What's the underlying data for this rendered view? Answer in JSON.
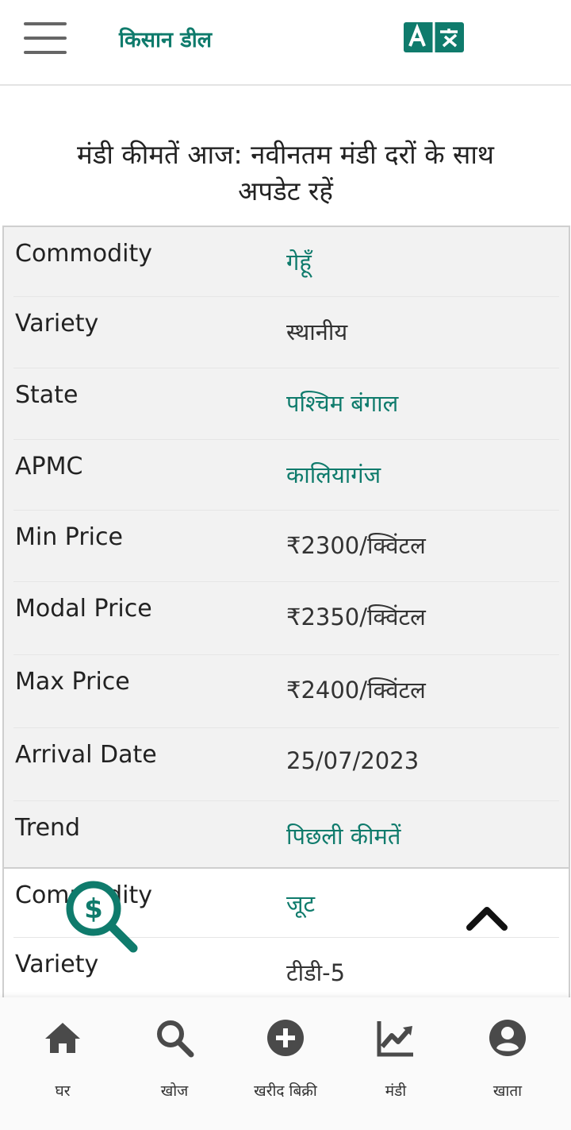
{
  "header": {
    "brand": "किसान डील",
    "translate_icon": "translate-icon"
  },
  "page": {
    "title": "मंडी कीमतें आज: नवीनतम मंडी दरों के साथ अपडेट रहें"
  },
  "cards": [
    {
      "rows": [
        {
          "label": "Commodity",
          "value": "गेहूँ"
        },
        {
          "label": "Variety",
          "value": "स्थानीय"
        },
        {
          "label": "State",
          "value": "पश्चिम बंगाल"
        },
        {
          "label": "APMC",
          "value": "कालियागंज"
        },
        {
          "label": "Min Price",
          "value": "₹2300/क्विंटल"
        },
        {
          "label": "Modal Price",
          "value": "₹2350/क्विंटल"
        },
        {
          "label": "Max Price",
          "value": "₹2400/क्विंटल"
        },
        {
          "label": "Arrival Date",
          "value": "25/07/2023"
        },
        {
          "label": "Trend",
          "value": "पिछली कीमतें"
        }
      ]
    },
    {
      "rows": [
        {
          "label": "Commodity",
          "value": "जूट"
        },
        {
          "label": "Variety",
          "value": "टीडी-5"
        }
      ]
    }
  ],
  "floating": {
    "search_icon": "price-search-icon",
    "scroll_icon": "chevron-up-icon"
  },
  "bottom_nav": [
    {
      "label": "घर",
      "icon": "home-icon"
    },
    {
      "label": "खोज",
      "icon": "search-icon"
    },
    {
      "label": "खरीद बिक्री",
      "icon": "add-circle-icon"
    },
    {
      "label": "मंडी",
      "icon": "trending-up-icon"
    },
    {
      "label": "खाता",
      "icon": "account-icon"
    }
  ],
  "colors": {
    "accent": "#0f7b6c",
    "card_bg": "#f2f2f2"
  }
}
